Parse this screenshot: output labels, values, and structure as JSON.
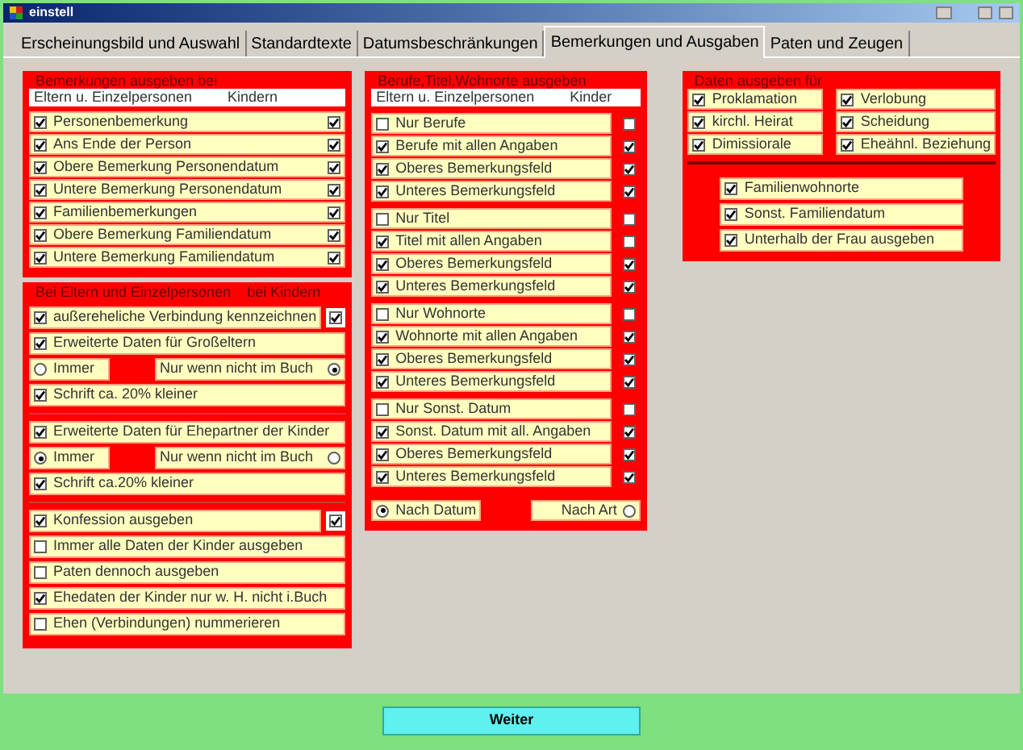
{
  "window": {
    "title": "einstell"
  },
  "tabs": [
    {
      "label": "Erscheinungsbild und Auswahl",
      "selected": false
    },
    {
      "label": "Standardtexte",
      "selected": false
    },
    {
      "label": "Datumsbeschränkungen",
      "selected": false
    },
    {
      "label": "Bemerkungen und Ausgaben",
      "selected": true
    },
    {
      "label": "Paten und Zeugen",
      "selected": false
    }
  ],
  "remarks": {
    "title": "Bemerkungen ausgeben bei",
    "columns": [
      "Eltern u. Einzelpersonen",
      "Kindern"
    ],
    "rows": [
      {
        "label": "Personenbemerkung",
        "checked": true,
        "child_checked": true
      },
      {
        "label": "Ans Ende der Person",
        "checked": true,
        "child_checked": true
      },
      {
        "label": "Obere  Bemerkung  Personendatum",
        "checked": true,
        "child_checked": true
      },
      {
        "label": "Untere Bemerkung  Personendatum",
        "checked": true,
        "child_checked": true
      },
      {
        "label": "Familienbemerkungen",
        "checked": true,
        "child_checked": true
      },
      {
        "label": "Obere  Bemerkung Familiendatum",
        "checked": true,
        "child_checked": true
      },
      {
        "label": "Untere  Bemerkung Familiendatum",
        "checked": true,
        "child_checked": true
      }
    ]
  },
  "parents": {
    "title": [
      "Bei Eltern und Einzelpersonen",
      "bei Kindern"
    ],
    "sections": [
      [
        {
          "kind": "check",
          "label": "außereheliche Verbindung kennzeichnen",
          "checked": true,
          "child_checked": true
        },
        {
          "kind": "check",
          "label": "Erweiterte Daten für Großeltern",
          "checked": true
        },
        {
          "kind": "radio_pair",
          "options": [
            {
              "label": "Immer",
              "selected": false
            },
            {
              "label": "Nur wenn nicht im Buch",
              "selected": true
            }
          ]
        },
        {
          "kind": "check",
          "label": "Schrift ca. 20% kleiner",
          "checked": true
        }
      ],
      [
        {
          "kind": "check",
          "label": "Erweiterte Daten für Ehepartner der Kinder",
          "checked": true
        },
        {
          "kind": "radio_pair",
          "options": [
            {
              "label": "Immer",
              "selected": true
            },
            {
              "label": "Nur wenn nicht im Buch",
              "selected": false
            }
          ]
        },
        {
          "kind": "check",
          "label": "Schrift ca.20% kleiner",
          "checked": true
        }
      ],
      [
        {
          "kind": "check",
          "label": "Konfession ausgeben",
          "checked": true,
          "child_checked": true
        },
        {
          "kind": "check",
          "label": "Immer alle Daten der Kinder ausgeben",
          "checked": false
        },
        {
          "kind": "check",
          "label": "Paten dennoch ausgeben",
          "checked": false
        },
        {
          "kind": "check",
          "label": "Ehedaten der Kinder nur w. H. nicht i.Buch",
          "checked": true
        },
        {
          "kind": "check",
          "label": "Ehen (Verbindungen) nummerieren",
          "checked": false
        }
      ]
    ]
  },
  "occupations": {
    "title": "Berufe,Titel,Wohnorte ausgeben",
    "columns": [
      "Eltern u. Einzelpersonen",
      "Kinder"
    ],
    "blocks": [
      [
        {
          "label": "Nur Berufe",
          "checked": false,
          "child_checked": false
        },
        {
          "label": "Berufe mit allen Angaben",
          "checked": true,
          "child_checked": true
        },
        {
          "label": "Oberes Bemerkungsfeld",
          "checked": true,
          "child_checked": true
        },
        {
          "label": "Unteres  Bemerkungsfeld",
          "checked": true,
          "child_checked": true
        }
      ],
      [
        {
          "label": "Nur Titel",
          "checked": false,
          "child_checked": false
        },
        {
          "label": "Titel mit allen Angaben",
          "checked": true,
          "child_checked": false
        },
        {
          "label": "Oberes Bemerkungsfeld",
          "checked": true,
          "child_checked": true
        },
        {
          "label": "Unteres  Bemerkungsfeld",
          "checked": true,
          "child_checked": true
        }
      ],
      [
        {
          "label": "Nur Wohnorte",
          "checked": false,
          "child_checked": false
        },
        {
          "label": "Wohnorte mit allen Angaben",
          "checked": true,
          "child_checked": true
        },
        {
          "label": "Oberes Bemerkungsfeld",
          "checked": true,
          "child_checked": true
        },
        {
          "label": "Unteres  Bemerkungsfeld",
          "checked": true,
          "child_checked": true
        }
      ],
      [
        {
          "label": "Nur Sonst. Datum",
          "checked": false,
          "child_checked": false
        },
        {
          "label": "Sonst. Datum mit all. Angaben",
          "checked": true,
          "child_checked": true
        },
        {
          "label": "Oberes Bemerkungsfeld",
          "checked": true,
          "child_checked": true
        },
        {
          "label": "Unteres  Bemerkungsfeld",
          "checked": true,
          "child_checked": true
        }
      ]
    ],
    "sort": [
      {
        "label": "Nach Datum",
        "selected": true
      },
      {
        "label": "Nach Art",
        "selected": false
      }
    ]
  },
  "events": {
    "title": "Daten ausgeben für",
    "items": [
      {
        "label": "Proklamation",
        "checked": true
      },
      {
        "label": "Verlobung",
        "checked": true
      },
      {
        "label": "kirchl. Heirat",
        "checked": true
      },
      {
        "label": "Scheidung",
        "checked": true
      },
      {
        "label": "Dimissiorale",
        "checked": true
      },
      {
        "label": "Eheähnl. Beziehung",
        "checked": true
      }
    ],
    "family": [
      {
        "label": "Familienwohnorte",
        "checked": true
      },
      {
        "label": "Sonst. Familiendatum",
        "checked": true
      },
      {
        "label": "Unterhalb der Frau ausgeben",
        "checked": true
      }
    ]
  },
  "next_button": "Weiter"
}
